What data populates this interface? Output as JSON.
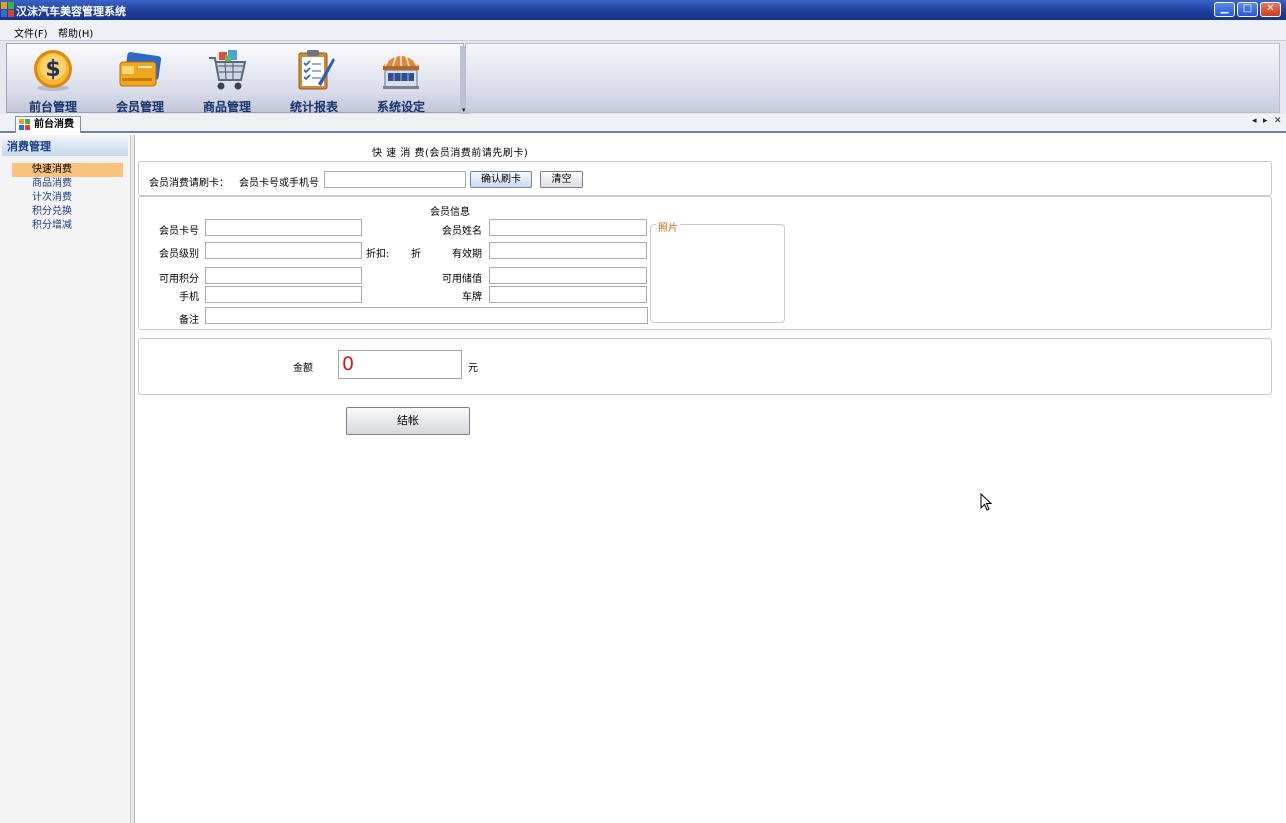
{
  "window": {
    "title": "汉沫汽车美容管理系统",
    "controls": {
      "minimize": "▁",
      "maximize": "□",
      "close": "✕"
    }
  },
  "menu": {
    "items": [
      "文件(F)",
      "帮助(H)"
    ]
  },
  "toolbar": {
    "buttons": [
      {
        "label": "前台管理",
        "icon": "coin-dollar-icon"
      },
      {
        "label": "会员管理",
        "icon": "member-card-icon"
      },
      {
        "label": "商品管理",
        "icon": "shopping-cart-icon"
      },
      {
        "label": "统计报表",
        "icon": "clipboard-report-icon"
      },
      {
        "label": "系统设定",
        "icon": "storefront-settings-icon"
      }
    ],
    "overflow": "▾"
  },
  "tabs": {
    "active": "前台消费",
    "nav": {
      "prev": "◂",
      "next": "▸",
      "close": "✕"
    }
  },
  "sidebar": {
    "header": "消费管理",
    "items": [
      {
        "label": "快速消费",
        "active": true
      },
      {
        "label": "商品消费",
        "active": false
      },
      {
        "label": "计次消费",
        "active": false
      },
      {
        "label": "积分兑换",
        "active": false
      },
      {
        "label": "积分增减",
        "active": false
      }
    ]
  },
  "main": {
    "heading": "快 速 消 费(会员消费前请先刷卡)",
    "swipe": {
      "prompt": "会员消费请刷卡：",
      "field_label": "会员卡号或手机号",
      "field_value": "",
      "confirm_button": "确认刷卡",
      "clear_button": "清空"
    },
    "member_info": {
      "title": "会员信息",
      "card_no_label": "会员卡号",
      "name_label": "会员姓名",
      "level_label": "会员级别",
      "discount_label": "折扣:",
      "discount_value": "折",
      "expiry_label": "有效期",
      "points_label": "可用积分",
      "balance_label": "可用储值",
      "phone_label": "手机",
      "plate_label": "车牌",
      "remark_label": "备注",
      "photo_label": "照片"
    },
    "amount": {
      "label": "金额",
      "value": "0",
      "unit": "元"
    },
    "checkout_button": "结帐"
  },
  "colors": {
    "title_bar": "#1e3f9c",
    "active_nav": "#f9c37e",
    "amount_text": "#d41a1a",
    "toolbar_label": "#15356b"
  }
}
